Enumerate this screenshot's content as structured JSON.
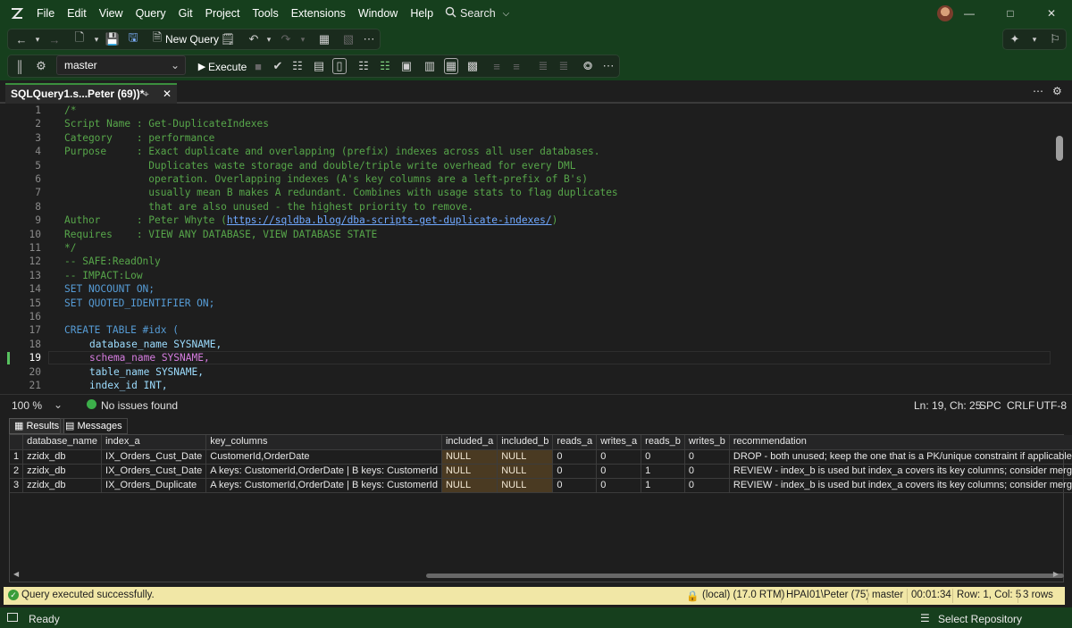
{
  "menu": [
    "File",
    "Edit",
    "View",
    "Query",
    "Git",
    "Project",
    "Tools",
    "Extensions",
    "Window",
    "Help"
  ],
  "search_label": "Search",
  "toolbar": {
    "new_query": "New Query",
    "database": "master",
    "execute": "Execute"
  },
  "tab": {
    "title": "SQLQuery1.s...Peter (69))*"
  },
  "editor": {
    "line_numbers": [
      "1",
      "2",
      "3",
      "4",
      "5",
      "6",
      "7",
      "8",
      "9",
      "10",
      "11",
      "12",
      "13",
      "14",
      "15",
      "16",
      "17",
      "18",
      "19",
      "20",
      "21"
    ],
    "lines": [
      "/*",
      "Script Name : Get-DuplicateIndexes",
      "Category    : performance",
      "Purpose     : Exact duplicate and overlapping (prefix) indexes across all user databases.",
      "              Duplicates waste storage and double/triple write overhead for every DML",
      "              operation. Overlapping indexes (A's key columns are a left-prefix of B's)",
      "              usually mean B makes A redundant. Combines with usage stats to flag duplicates",
      "              that are also unused - the highest priority to remove.",
      "Author      : Peter Whyte (",
      "https://sqldba.blog/dba-scripts-get-duplicate-indexes/",
      ")",
      "Requires    : VIEW ANY DATABASE, VIEW DATABASE STATE",
      "*/",
      "-- SAFE:ReadOnly",
      "-- IMPACT:Low",
      "SET NOCOUNT ON;",
      "SET QUOTED_IDENTIFIER ON;",
      "CREATE TABLE #idx (",
      "database_name SYSNAME,",
      "schema_name SYSNAME,",
      "table_name SYSNAME,",
      "index_id INT,"
    ]
  },
  "editor_status": {
    "zoom": "100 %",
    "issues": "No issues found",
    "position": "Ln: 19, Ch: 25",
    "whitespace": "SPC",
    "line_ending": "CRLF",
    "encoding": "UTF-8"
  },
  "results_tabs": [
    "Results",
    "Messages"
  ],
  "grid": {
    "columns": [
      "database_name",
      "index_a",
      "key_columns",
      "included_a",
      "included_b",
      "reads_a",
      "writes_a",
      "reads_b",
      "writes_b",
      "recommendation"
    ],
    "rows": [
      [
        "1",
        "zzidx_db",
        "IX_Orders_Cust_Date",
        "CustomerId,OrderDate",
        "NULL",
        "NULL",
        "0",
        "0",
        "0",
        "0",
        "DROP - both unused; keep the one that is a PK/unique constraint if applicable"
      ],
      [
        "2",
        "zzidx_db",
        "IX_Orders_Cust_Date",
        "A keys: CustomerId,OrderDate | B keys: CustomerId",
        "NULL",
        "NULL",
        "0",
        "0",
        "1",
        "0",
        "REVIEW - index_b is used but index_a covers its key columns; consider merging"
      ],
      [
        "3",
        "zzidx_db",
        "IX_Orders_Duplicate",
        "A keys: CustomerId,OrderDate | B keys: CustomerId",
        "NULL",
        "NULL",
        "0",
        "0",
        "1",
        "0",
        "REVIEW - index_b is used but index_a covers its key columns; consider merging"
      ]
    ]
  },
  "query_status": {
    "message": "Query executed successfully.",
    "server": "(local) (17.0 RTM)",
    "login": "HPAI01\\Peter (75)",
    "database": "master",
    "elapsed": "00:01:34",
    "rowcol": "Row: 1, Col: 5",
    "rows": "3 rows"
  },
  "app_status": {
    "ready": "Ready",
    "repo": "Select Repository"
  },
  "colors": {
    "chrome": "#163f1d",
    "accent": "#3b8e3e",
    "status_yellow": "#f1e7a6",
    "null_cell": "#4a3a22"
  }
}
